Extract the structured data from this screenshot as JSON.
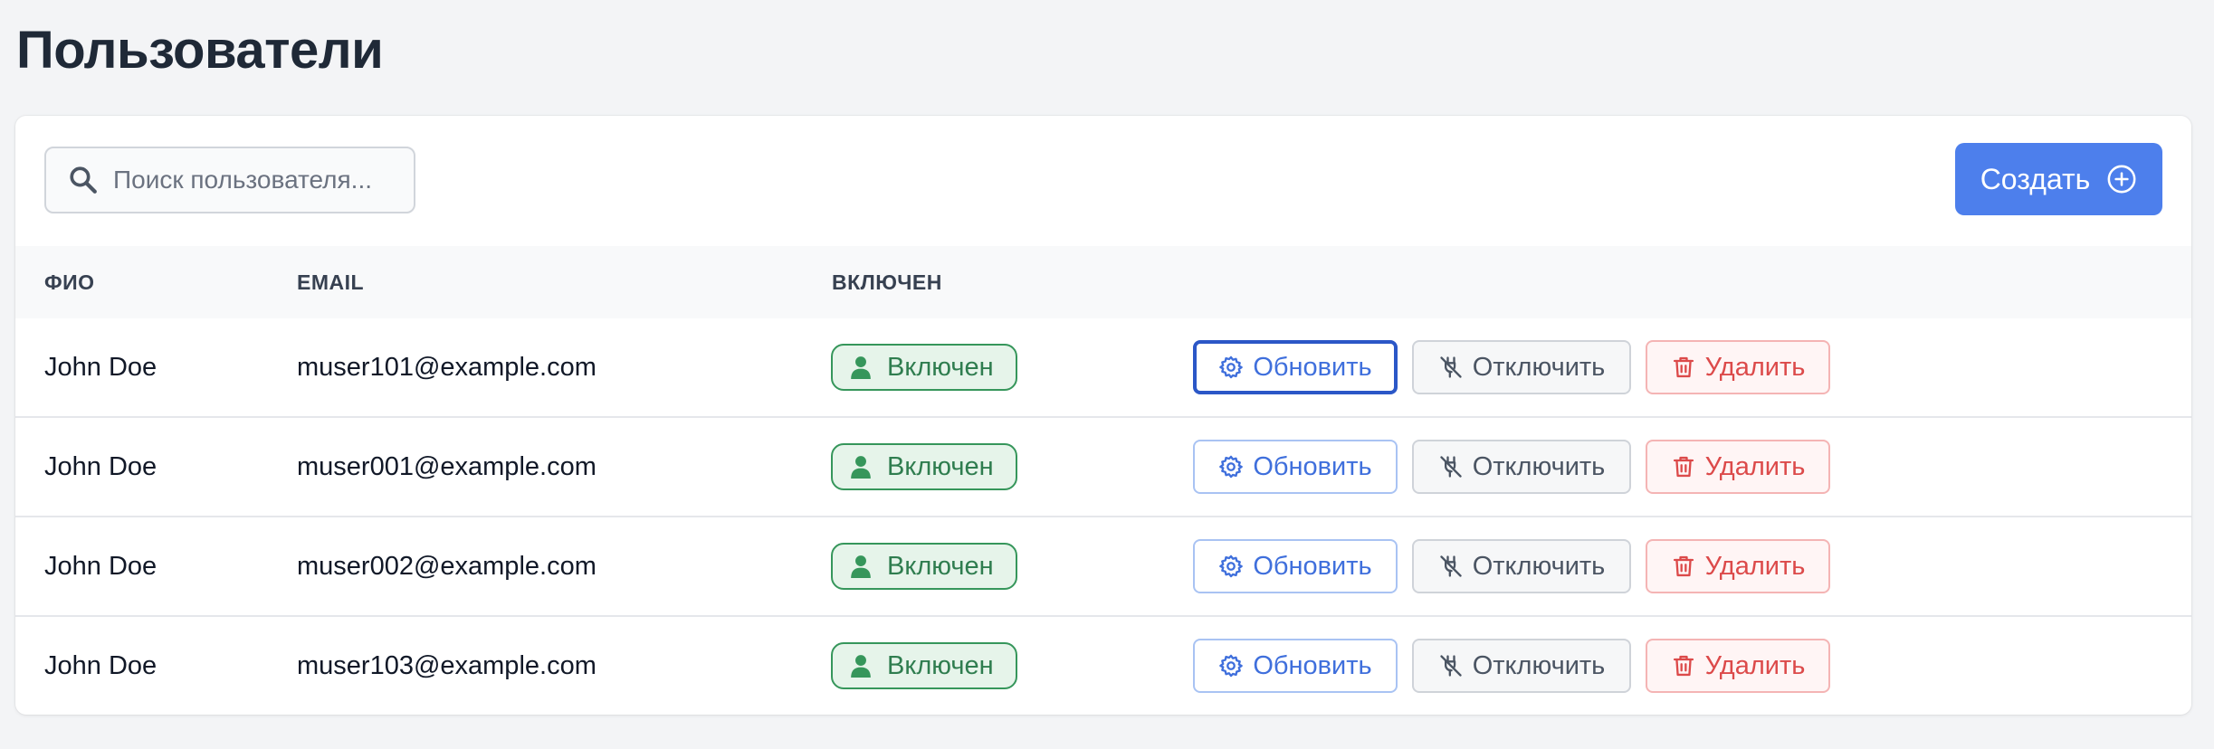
{
  "page": {
    "title": "Пользователи"
  },
  "toolbar": {
    "search_placeholder": "Поиск пользователя...",
    "create_label": "Создать"
  },
  "table": {
    "headers": {
      "name": "ФИО",
      "email": "EMAIL",
      "enabled": "ВКЛЮЧЕН"
    },
    "rows": [
      {
        "name": "John Doe",
        "email": "muser101@example.com",
        "status": "Включен",
        "update_label": "Обновить",
        "disable_label": "Отключить",
        "delete_label": "Удалить"
      },
      {
        "name": "John Doe",
        "email": "muser001@example.com",
        "status": "Включен",
        "update_label": "Обновить",
        "disable_label": "Отключить",
        "delete_label": "Удалить"
      },
      {
        "name": "John Doe",
        "email": "muser002@example.com",
        "status": "Включен",
        "update_label": "Обновить",
        "disable_label": "Отключить",
        "delete_label": "Удалить"
      },
      {
        "name": "John Doe",
        "email": "muser103@example.com",
        "status": "Включен",
        "update_label": "Обновить",
        "disable_label": "Отключить",
        "delete_label": "Удалить"
      }
    ]
  },
  "icons": {
    "search": "search-icon",
    "create": "plus-circle-icon",
    "status": "user-icon",
    "update": "gear-icon",
    "disable": "plug-off-icon",
    "delete": "trash-icon"
  },
  "colors": {
    "primary": "#4d7fec",
    "success": "#36965b",
    "success_bg": "#e6f4ea",
    "danger": "#dc4a4a",
    "danger_bg": "#fff5f5",
    "neutral": "#4b5563",
    "page_bg": "#f3f4f6"
  }
}
